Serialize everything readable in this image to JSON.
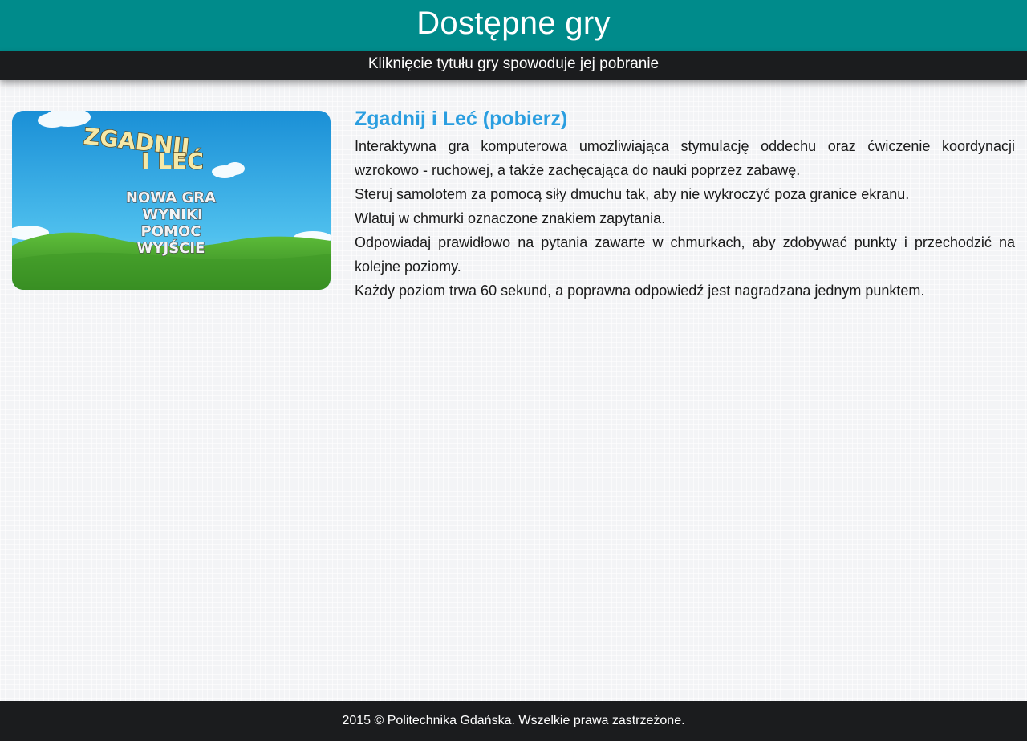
{
  "header": {
    "title": "Dostępne gry",
    "subtitle": "Kliknięcie tytułu gry spowoduje jej pobranie"
  },
  "game": {
    "title": "Zgadnij i Leć (pobierz)",
    "thumbnail": {
      "logo_line1": "ZGADNIJ",
      "logo_line2": "I LEĆ",
      "menu": [
        "NOWA GRA",
        "WYNIKI",
        "POMOC",
        "WYJŚCIE"
      ]
    },
    "description": [
      "Interaktywna gra komputerowa umożliwiająca stymulację oddechu oraz ćwiczenie koordynacji wzrokowo - ruchowej, a także zachęcająca do nauki poprzez zabawę.",
      "Steruj samolotem za pomocą siły dmuchu tak, aby nie wykroczyć poza granice ekranu.",
      "Wlatuj w chmurki oznaczone znakiem zapytania.",
      "Odpowiadaj prawidłowo na pytania zawarte w chmurkach, aby zdobywać punkty i przechodzić na kolejne poziomy.",
      "Każdy poziom trwa 60 sekund, a poprawna odpowiedź jest nagradzana jednym punktem."
    ]
  },
  "footer": {
    "text": "2015 © Politechnika Gdańska. Wszelkie prawa zastrzeżone."
  },
  "colors": {
    "header_bg": "#008b8b",
    "bar_bg": "#1b1c1e",
    "link": "#2a9ee0"
  }
}
